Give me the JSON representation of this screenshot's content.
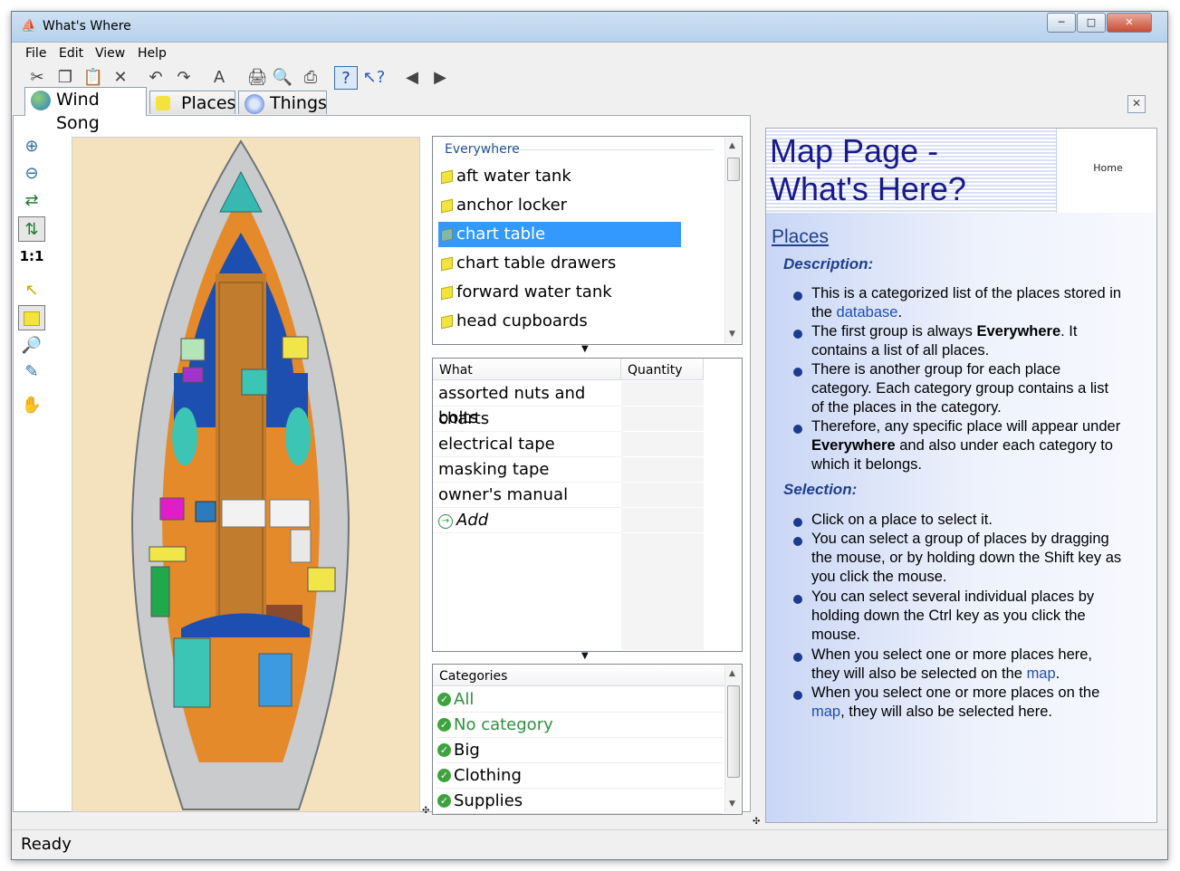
{
  "window": {
    "title": "What's Where",
    "controls": {
      "minimize": "─",
      "maximize": "□",
      "close": "✕"
    }
  },
  "menu": [
    "File",
    "Edit",
    "View",
    "Help"
  ],
  "tabs": [
    {
      "label": "Wind Song",
      "icon": "globe-icon"
    },
    {
      "label": "Places",
      "icon": "cube-icon"
    },
    {
      "label": "Things",
      "icon": "gear-icon"
    }
  ],
  "map_tools": {
    "one_to_one": "1:1"
  },
  "places": {
    "group": "Everywhere",
    "items": [
      "aft water tank",
      "anchor locker",
      "chart table",
      "chart table drawers",
      "forward water tank",
      "head cupboards"
    ],
    "selected": "chart table"
  },
  "things": {
    "headers": {
      "what": "What",
      "quantity": "Quantity"
    },
    "rows": [
      "assorted nuts and bolts",
      "charts",
      "electrical tape",
      "masking tape",
      "owner's manual"
    ],
    "add_label": "Add"
  },
  "categories": {
    "header": "Categories",
    "items": [
      "All",
      "No category",
      "Big",
      "Clothing",
      "Supplies"
    ]
  },
  "help": {
    "title_line1": "Map Page -",
    "title_line2": "What's Here?",
    "home": "Home",
    "section": "Places",
    "description_heading": "Description:",
    "selection_heading": "Selection:",
    "d1a": "This is a categorized list of the places stored in",
    "d1b": "the ",
    "d1_link": "database",
    "d1c": ".",
    "d2a": "The first group is always ",
    "d2_bold": "Everywhere",
    "d2b": ".  It",
    "d2c": "contains a list of all places.",
    "d3a": "There is another group for each place",
    "d3b": "category.  Each category group contains a list",
    "d3c": "of the places in the category.",
    "d4a": "Therefore, any specific place will appear under",
    "d4_bold": "Everywhere",
    "d4b": " and also under each category to",
    "d4c": "which it belongs.",
    "s1": "Click on a place to select it.",
    "s2a": "You can select a group of places by dragging",
    "s2b": "the mouse, or by holding down the Shift key as",
    "s2c": "you click the mouse.",
    "s3a": "You can select several individual places by",
    "s3b": "holding down the Ctrl key as you click the",
    "s3c": "mouse.",
    "s4a": "When you select one or more places here,",
    "s4b": "they will also be selected on the ",
    "s4_link": "map",
    "s4c": ".",
    "s5a": "When you select one or more places on the",
    "s5_link": "map",
    "s5b": ", they will also be selected here."
  },
  "status": "Ready"
}
